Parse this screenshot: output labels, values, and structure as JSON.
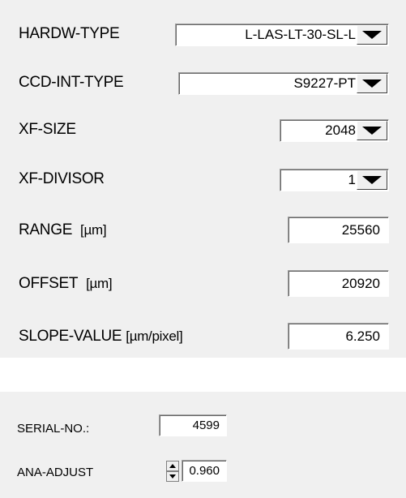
{
  "settings": {
    "hardw_type": {
      "label": "HARDW-TYPE",
      "value": "L-LAS-LT-30-SL-L"
    },
    "ccd_int_type": {
      "label": "CCD-INT-TYPE",
      "value": "S9227-PT"
    },
    "xf_size": {
      "label": "XF-SIZE",
      "value": "2048"
    },
    "xf_divisor": {
      "label": "XF-DIVISOR",
      "value": "1"
    },
    "range": {
      "label": "RANGE",
      "unit": "[µm]",
      "value": "25560"
    },
    "offset": {
      "label": "OFFSET",
      "unit": "[µm]",
      "value": "20920"
    },
    "slope_value": {
      "label": "SLOPE-VALUE",
      "unit": "[µm/pixel]",
      "value": "6.250"
    }
  },
  "info": {
    "serial_no": {
      "label": "SERIAL-NO.:",
      "value": "4599"
    },
    "ana_adjust": {
      "label": "ANA-ADJUST",
      "value": "0.960"
    }
  },
  "colors": {
    "panel_bg": "#f0f0f0",
    "field_bg": "#ffffff"
  },
  "icons": {
    "dropdown": "dropdown-arrow-icon",
    "spinner": "up-down-spinner-icon"
  }
}
